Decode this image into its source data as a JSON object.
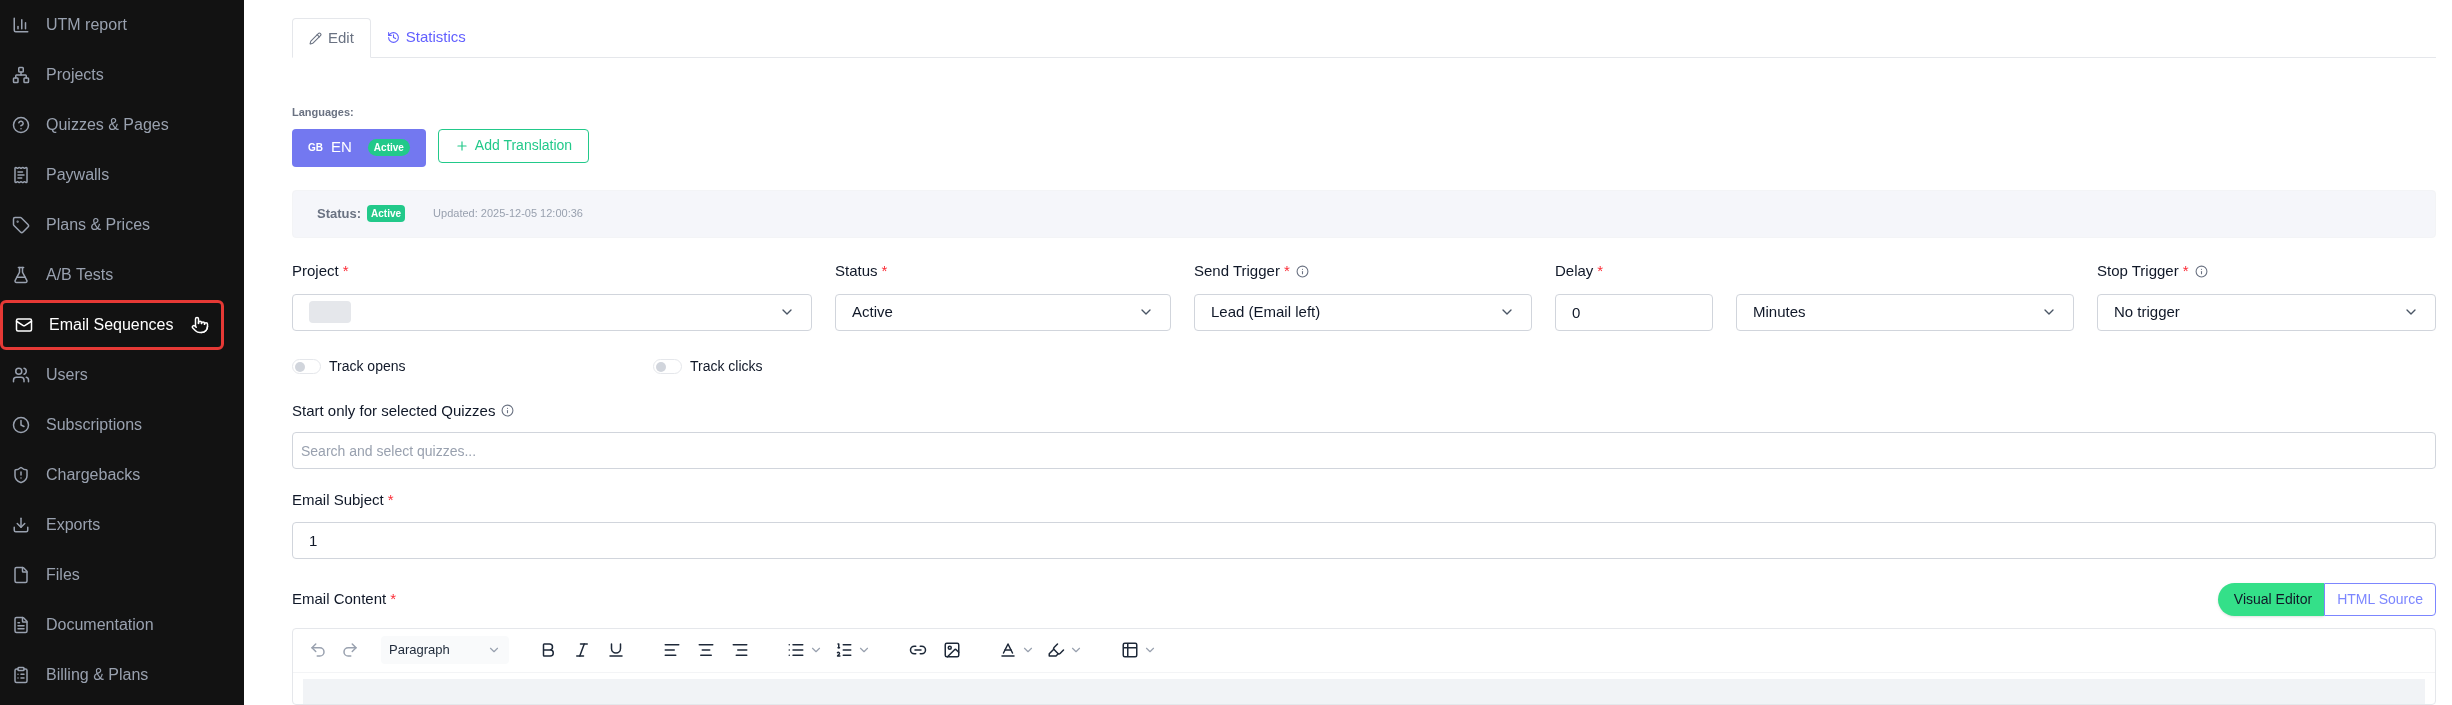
{
  "sidebar": {
    "items": [
      {
        "label": "UTM report",
        "selected": false
      },
      {
        "label": "Projects",
        "selected": false
      },
      {
        "label": "Quizzes & Pages",
        "selected": false
      },
      {
        "label": "Paywalls",
        "selected": false
      },
      {
        "label": "Plans & Prices",
        "selected": false
      },
      {
        "label": "A/B Tests",
        "selected": false
      },
      {
        "label": "Email Sequences",
        "selected": true
      },
      {
        "label": "Users",
        "selected": false
      },
      {
        "label": "Subscriptions",
        "selected": false
      },
      {
        "label": "Chargebacks",
        "selected": false
      },
      {
        "label": "Exports",
        "selected": false
      },
      {
        "label": "Files",
        "selected": false
      },
      {
        "label": "Documentation",
        "selected": false
      },
      {
        "label": "Billing & Plans",
        "selected": false
      }
    ]
  },
  "tabs": [
    {
      "label": "Edit",
      "selected": true
    },
    {
      "label": "Statistics",
      "selected": false
    }
  ],
  "languages": {
    "label": "Languages:",
    "items": [
      {
        "code": "GB",
        "label": "EN",
        "badge": "Active"
      }
    ],
    "add_button": "Add Translation"
  },
  "status_bar": {
    "label": "Status:",
    "badge": "Active",
    "updated": "Updated: 2025-12-05 12:00:36"
  },
  "fields": [
    {
      "kind": "select",
      "label": "Project",
      "mark": "*",
      "redacted": true
    },
    {
      "kind": "select",
      "label": "Status",
      "mark": "*",
      "value": "Active"
    },
    {
      "kind": "select",
      "label": "Send Trigger",
      "mark": "*",
      "info": true,
      "value": "Lead (Email left)"
    },
    {
      "kind": "input",
      "label": "Delay",
      "mark": "*",
      "value": "0"
    },
    {
      "kind": "select",
      "value": "Minutes"
    },
    {
      "kind": "select",
      "label": "Stop Trigger",
      "mark": "*",
      "info": true,
      "value": "No trigger"
    }
  ],
  "toggles": [
    {
      "label": "Track opens",
      "on": false
    },
    {
      "label": "Track clicks",
      "on": false
    }
  ],
  "quizzes": {
    "label": "Start only for selected Quizzes",
    "info": true,
    "placeholder": "Search and select quizzes..."
  },
  "subject": {
    "label": "Email Subject",
    "mark": "*",
    "value": "1"
  },
  "content": {
    "label": "Email Content",
    "mark": "*",
    "modes": [
      {
        "label": "Visual Editor",
        "selected": true
      },
      {
        "label": "HTML Source",
        "selected": false
      }
    ],
    "block_format": "Paragraph"
  }
}
